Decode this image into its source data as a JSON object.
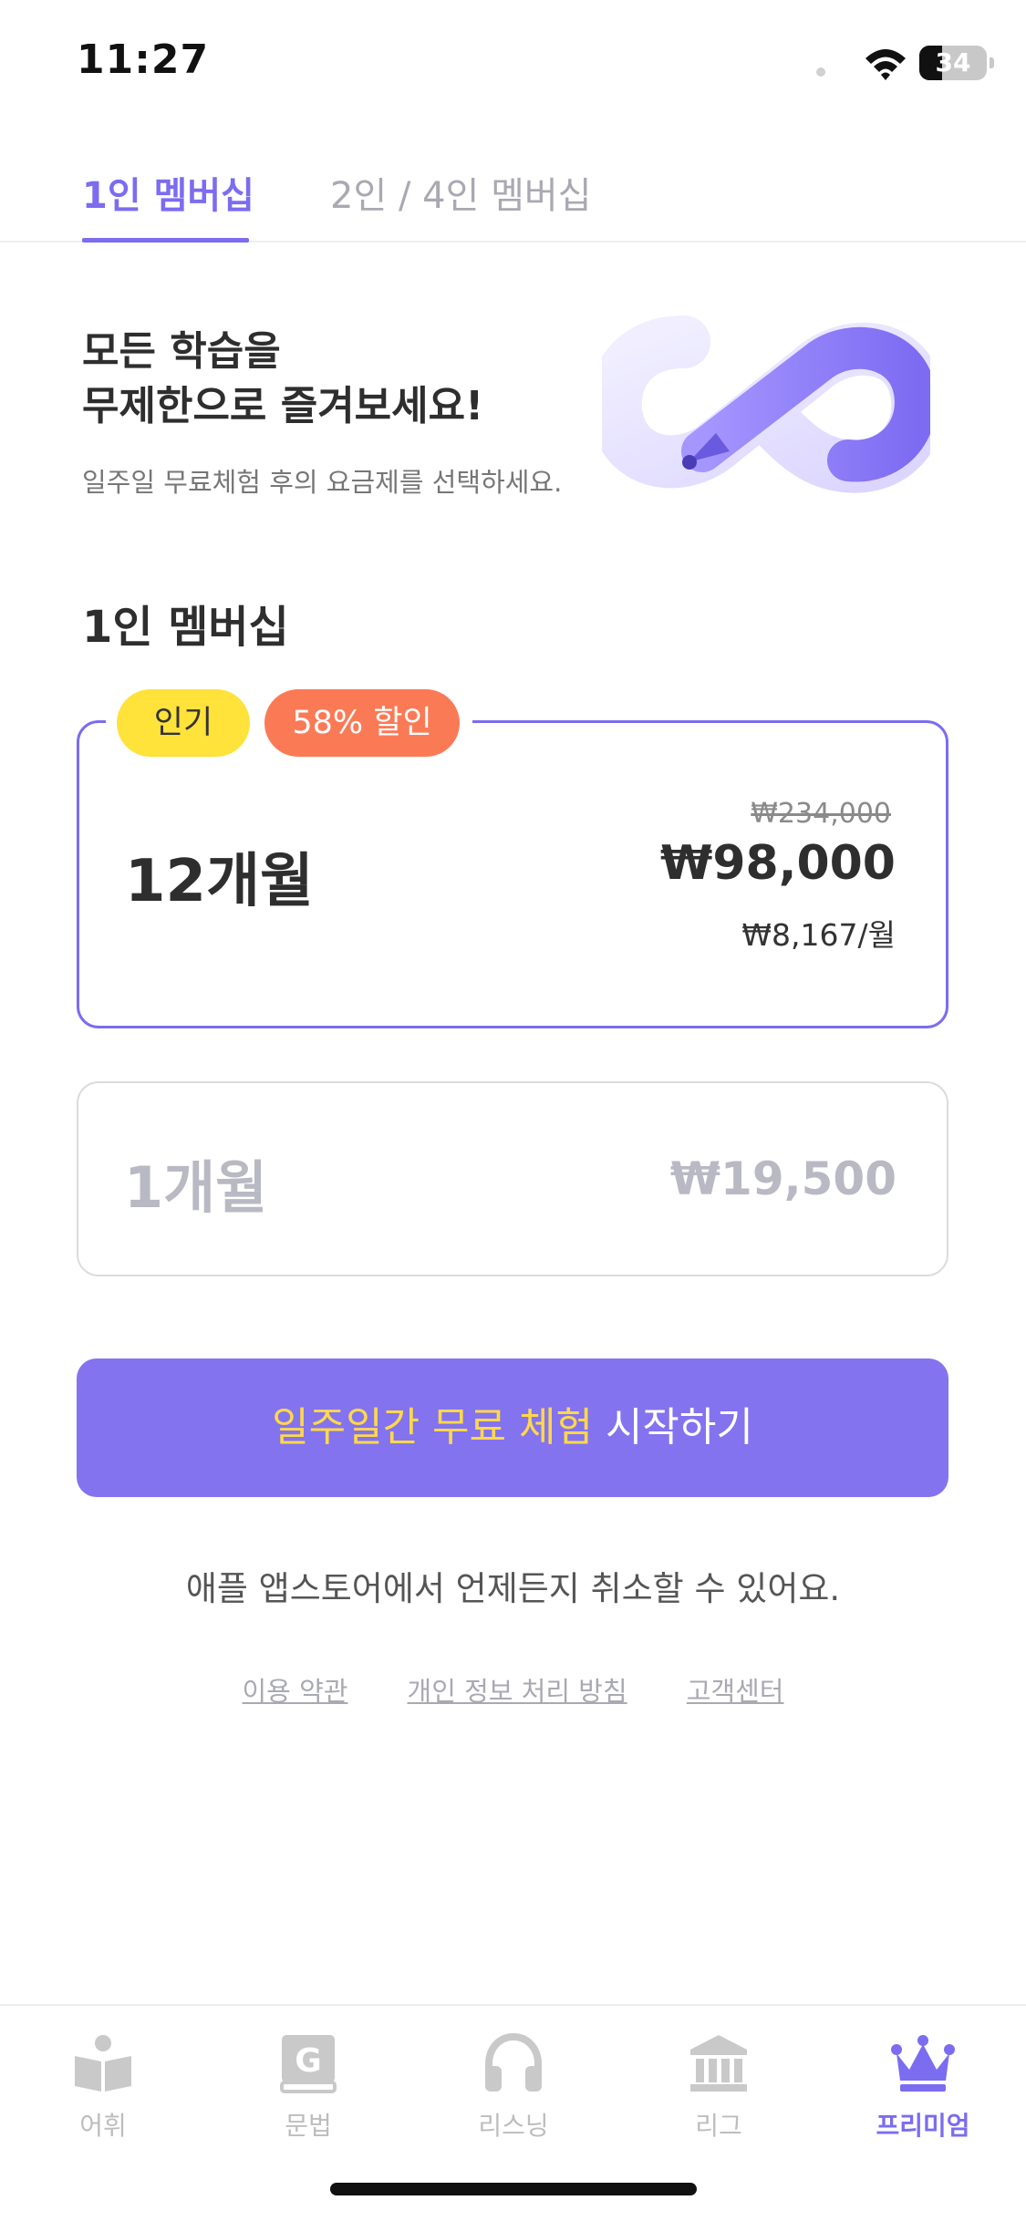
{
  "status_bar": {
    "time": "11:27",
    "battery_level": "34",
    "battery_fraction": 0.34
  },
  "tabs": [
    {
      "label": "1인 멤버십",
      "active": true
    },
    {
      "label": "2인 / 4인 멤버십",
      "active": false
    }
  ],
  "hero": {
    "title_line1": "모든 학습을",
    "title_line2": "무제한으로 즐겨보세요!",
    "subtitle": "일주일 무료체험 후의 요금제를 선택하세요.",
    "illustration_icon": "infinity-pencil-icon"
  },
  "section_title": "1인 멤버십",
  "plans": {
    "twelve_month": {
      "badge_popular": "인기",
      "badge_discount": "58% 할인",
      "name": "12개월",
      "original_price": "₩234,000",
      "price": "₩98,000",
      "monthly_price": "₩8,167/월",
      "selected": true
    },
    "one_month": {
      "name": "1개월",
      "price": "₩19,500",
      "selected": false
    }
  },
  "cta": {
    "highlight": "일주일간 무료 체험",
    "rest": " 시작하기"
  },
  "cancel_note": "애플 앱스토어에서 언제든지 취소할 수 있어요.",
  "footer_links": [
    "이용 약관",
    "개인 정보 처리 방침",
    "고객센터"
  ],
  "bottom_nav": [
    {
      "label": "어휘",
      "icon": "book-icon",
      "active": false
    },
    {
      "label": "문법",
      "icon": "grammar-book-icon",
      "active": false
    },
    {
      "label": "리스닝",
      "icon": "headphones-icon",
      "active": false
    },
    {
      "label": "리그",
      "icon": "building-icon",
      "active": false
    },
    {
      "label": "프리미엄",
      "icon": "crown-icon",
      "active": true
    }
  ],
  "colors": {
    "accent": "#7b6cf0",
    "cta_background": "#8373ef",
    "cta_highlight": "#ffd84a",
    "badge_popular": "#ffe23a",
    "badge_discount": "#fb7a56",
    "inactive": "#bdbdbd"
  }
}
